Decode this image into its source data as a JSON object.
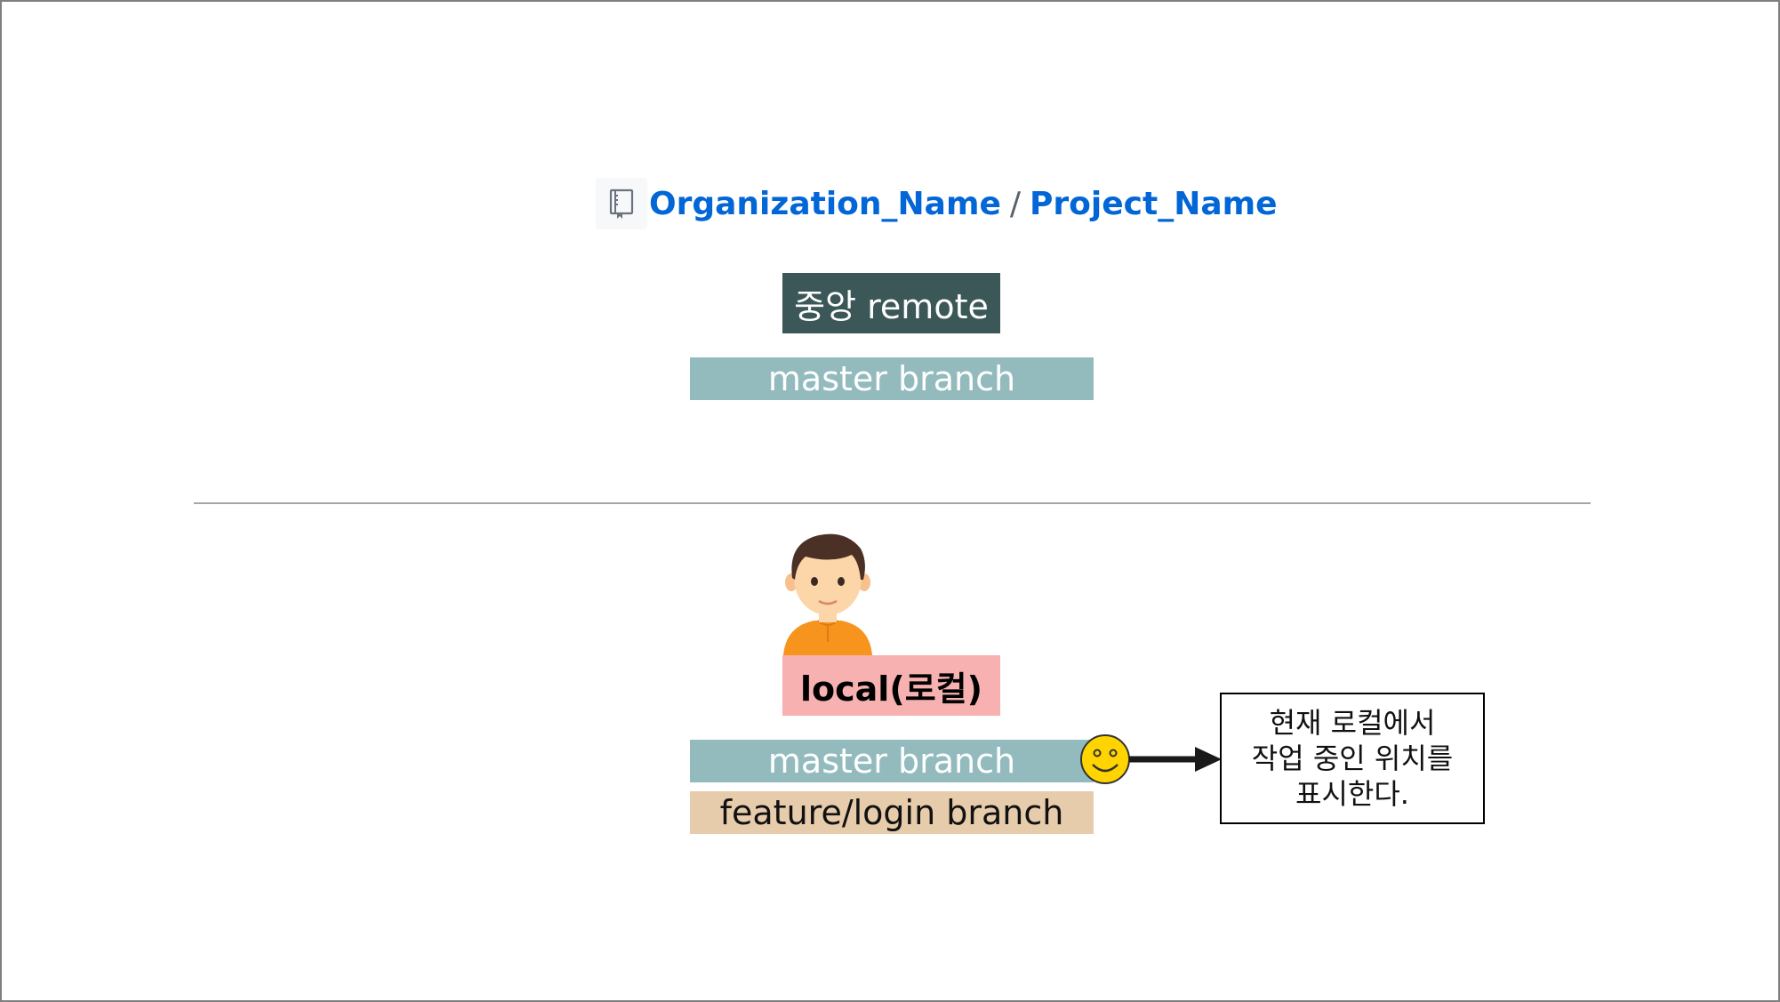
{
  "repo": {
    "organization": "Organization_Name",
    "separator": "/",
    "project": "Project_Name"
  },
  "remote": {
    "label": "중앙 remote",
    "branch": "master branch"
  },
  "local": {
    "label": "local(로컬)",
    "branches": [
      "master branch",
      "feature/login branch"
    ]
  },
  "note": {
    "lines": [
      "현재 로컬에서",
      "작업 중인 위치를",
      "표시한다."
    ]
  },
  "colors": {
    "remote_box": "#3b5757",
    "master_branch": "#93bbbd",
    "feature_branch": "#e7ccac",
    "local_box": "#f7b1b1",
    "link": "#0366d6",
    "smiley": "#ffd400"
  }
}
